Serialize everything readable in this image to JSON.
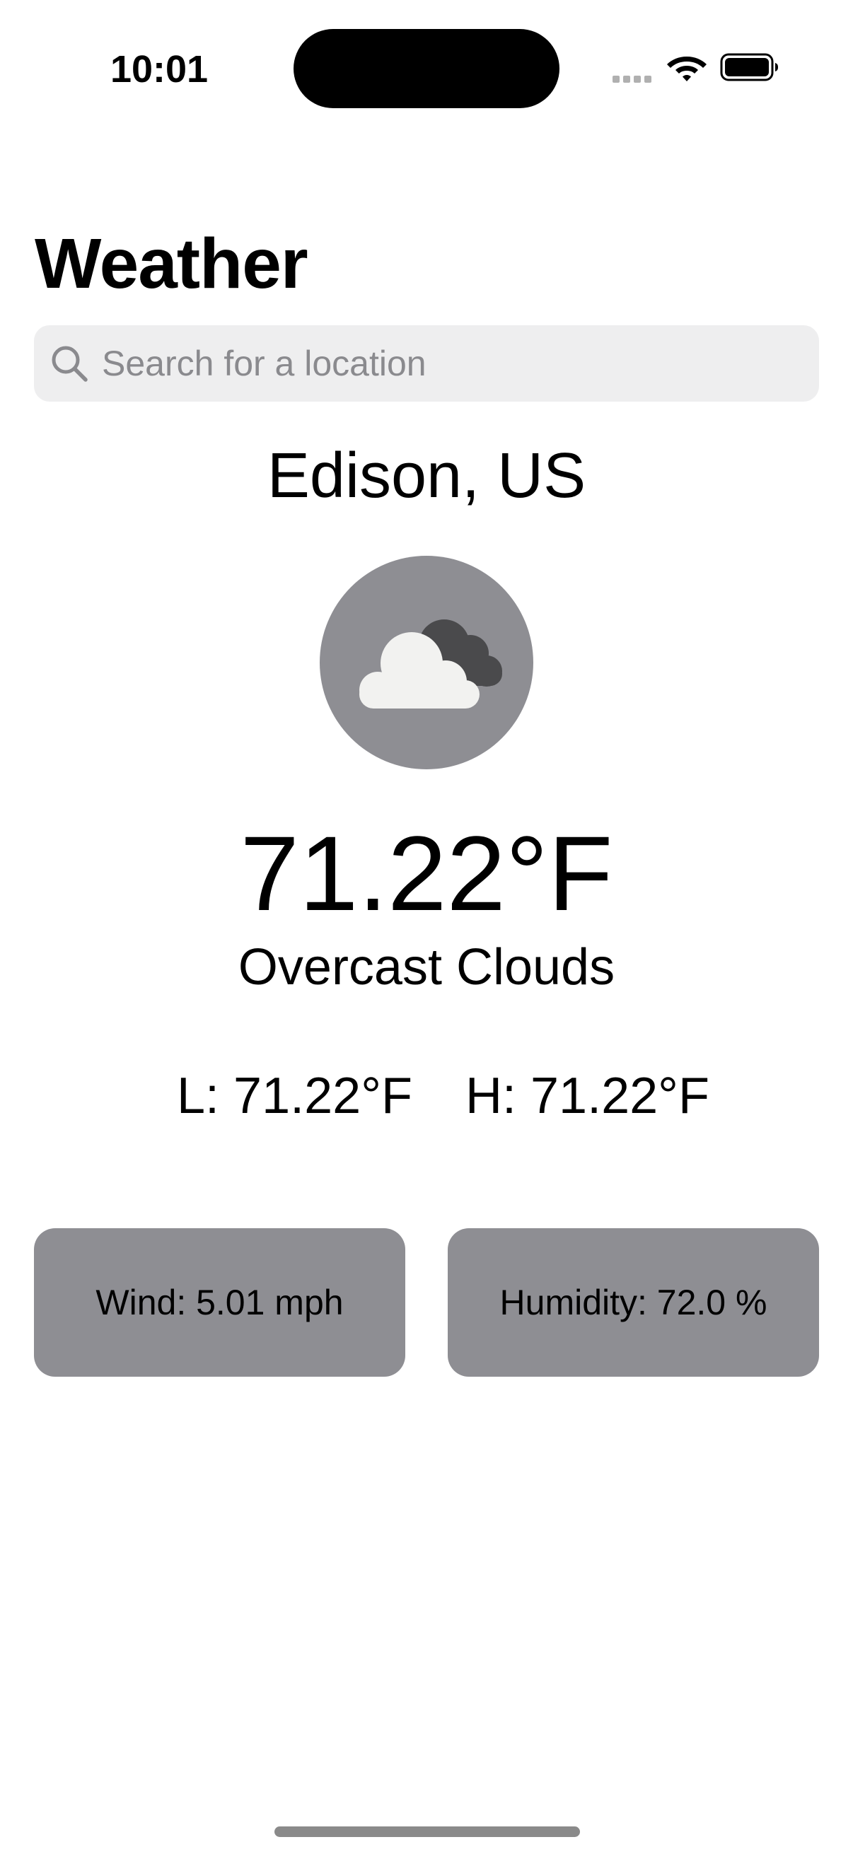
{
  "status_bar": {
    "time": "10:01"
  },
  "header": {
    "title": "Weather"
  },
  "search": {
    "placeholder": "Search for a location",
    "value": ""
  },
  "location": {
    "name": "Edison, US"
  },
  "current": {
    "icon": "overcast-clouds-icon",
    "temperature": "71.22°F",
    "condition": "Overcast Clouds",
    "low": "L: 71.22°F",
    "high": "H: 71.22°F"
  },
  "details": {
    "wind": "Wind: 5.01 mph",
    "humidity": "Humidity: 72.0 %"
  },
  "colors": {
    "card_background": "#8e8e93",
    "search_background": "#eeeeef",
    "icon_circle": "#8e8e93"
  }
}
